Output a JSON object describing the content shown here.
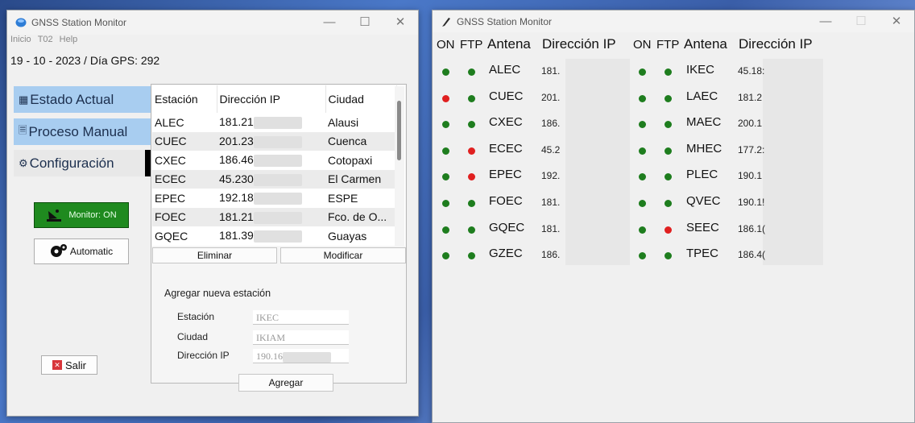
{
  "left_window": {
    "title": "GNSS Station Monitor",
    "menu": [
      "Inicio",
      "T02",
      "Help"
    ],
    "date_line": "19 - 10 - 2023 / Día GPS: 292",
    "sidebar": [
      {
        "label": "Estado Actual",
        "icon": "window-icon"
      },
      {
        "label": "Proceso Manual",
        "icon": "document-icon"
      },
      {
        "label": "Configuración",
        "icon": "gear-icon"
      }
    ],
    "monitor_label": "Monitor: ON",
    "automatic_label": "Automatic",
    "exit_label": "Salir",
    "table": {
      "headers": [
        "Estación",
        "Dirección IP",
        "Ciudad"
      ],
      "rows": [
        {
          "station": "ALEC",
          "ip": "181.21",
          "city": "Alausi"
        },
        {
          "station": "CUEC",
          "ip": "201.23",
          "city": "Cuenca"
        },
        {
          "station": "CXEC",
          "ip": "186.46",
          "city": "Cotopaxi"
        },
        {
          "station": "ECEC",
          "ip": "45.230",
          "city": "El Carmen"
        },
        {
          "station": "EPEC",
          "ip": "192.18",
          "city": "ESPE"
        },
        {
          "station": "FOEC",
          "ip": "181.21",
          "city": "Fco. de O..."
        },
        {
          "station": "GQEC",
          "ip": "181.39",
          "city": "Guayas"
        }
      ]
    },
    "delete_label": "Eliminar",
    "modify_label": "Modificar",
    "add_section": {
      "heading": "Agregar nueva estación",
      "station_label": "Estación",
      "station_value": "IKEC",
      "city_label": "Ciudad",
      "city_value": "IKIAM",
      "ip_label": "Dirección IP",
      "ip_value": "190.16",
      "add_label": "Agregar"
    }
  },
  "right_window": {
    "title": "GNSS Station Monitor",
    "headers": {
      "on": "ON",
      "ftp": "FTP",
      "antenna": "Antena",
      "ip": "Dirección IP"
    },
    "status_colors": {
      "ok": "#1e7d1e",
      "fail": "#e02020"
    },
    "col1": [
      {
        "antenna": "ALEC",
        "ip": "181.",
        "on": "ok",
        "ftp": "ok"
      },
      {
        "antenna": "CUEC",
        "ip": "201.",
        "on": "fail",
        "ftp": "ok"
      },
      {
        "antenna": "CXEC",
        "ip": "186.",
        "on": "ok",
        "ftp": "ok"
      },
      {
        "antenna": "ECEC",
        "ip": "45.2",
        "on": "ok",
        "ftp": "fail"
      },
      {
        "antenna": "EPEC",
        "ip": "192.",
        "on": "ok",
        "ftp": "fail"
      },
      {
        "antenna": "FOEC",
        "ip": "181.",
        "on": "ok",
        "ftp": "ok"
      },
      {
        "antenna": "GQEC",
        "ip": "181.",
        "on": "ok",
        "ftp": "ok"
      },
      {
        "antenna": "GZEC",
        "ip": "186.",
        "on": "ok",
        "ftp": "ok"
      }
    ],
    "col2": [
      {
        "antenna": "IKEC",
        "ip": "45.18:",
        "on": "ok",
        "ftp": "ok"
      },
      {
        "antenna": "LAEC",
        "ip": "181.2",
        "on": "ok",
        "ftp": "ok"
      },
      {
        "antenna": "MAEC",
        "ip": "200.1",
        "on": "ok",
        "ftp": "ok"
      },
      {
        "antenna": "MHEC",
        "ip": "177.2:",
        "on": "ok",
        "ftp": "ok"
      },
      {
        "antenna": "PLEC",
        "ip": "190.1",
        "on": "ok",
        "ftp": "ok"
      },
      {
        "antenna": "QVEC",
        "ip": "190.1!",
        "on": "ok",
        "ftp": "ok"
      },
      {
        "antenna": "SEEC",
        "ip": "186.1(",
        "on": "ok",
        "ftp": "fail"
      },
      {
        "antenna": "TPEC",
        "ip": "186.4(",
        "on": "ok",
        "ftp": "ok"
      }
    ]
  }
}
